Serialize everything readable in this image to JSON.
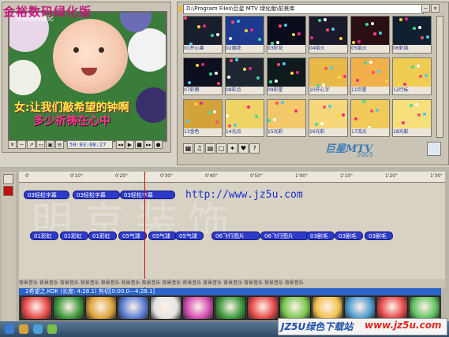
{
  "preview": {
    "title": "金裕数码绿化版",
    "subtitle": "金裕数码绿化",
    "lyric_line1": "让我们敲希望的钟啊",
    "lyric_line2": "多少祈祷在心中",
    "lyric_prefix": "女:",
    "timecode": "59:03:00:27"
  },
  "library": {
    "path": "D:\\Program Files\\巨星 MTV 绿化版\\前景库",
    "thumbs": [
      {
        "label": "01开心果",
        "color": "#1a1f2e"
      },
      {
        "label": "02烟花",
        "color": "#1d3a8e"
      },
      {
        "label": "03彩花",
        "color": "#0b0d1c"
      },
      {
        "label": "04焰火",
        "color": "#1a1a2a"
      },
      {
        "label": "05焰火",
        "color": "#2a0f14"
      },
      {
        "label": "06彩焰",
        "color": "#112030"
      },
      {
        "label": "07彩雨",
        "color": "#0c0f1d"
      },
      {
        "label": "08彩点",
        "color": "#1c2530"
      },
      {
        "label": "09彩星",
        "color": "#0f1a1d"
      },
      {
        "label": "10开心字",
        "color": "#e8b947"
      },
      {
        "label": "11巨星",
        "color": "#f2b04a"
      },
      {
        "label": "12行标",
        "color": "#f0cc52"
      },
      {
        "label": "13金色",
        "color": "#d4a23a"
      },
      {
        "label": "14光点",
        "color": "#efd364"
      },
      {
        "label": "15光彩",
        "color": "#f3c86a"
      },
      {
        "label": "16光彩",
        "color": "#f6d87a"
      },
      {
        "label": "17流光",
        "color": "#f2ca5a"
      },
      {
        "label": "18光影",
        "color": "#f7e07c"
      }
    ],
    "logo": "巨星MTV",
    "logo_year": "2003"
  },
  "timeline": {
    "ruler_ticks": [
      "0'",
      "0'10\"",
      "0'20\"",
      "0'30\"",
      "0'40\"",
      "0'50\"",
      "1'00\"",
      "1'10\"",
      "1'20\"",
      "1'30\""
    ],
    "watermark": "明京装饰",
    "url": "http://www.jz5u.com",
    "clips_row1": [
      "03轻松字幕",
      "03轻松字幕",
      "03轻松字幕"
    ],
    "clips_row2": [
      "01彩虹",
      "01彩虹",
      "01彩虹",
      "05气球",
      "05气球",
      "05气球",
      "06飞行图片",
      "06飞行图片",
      "03剧毛",
      "03剧毛",
      "03剧毛"
    ],
    "bg_track_label": "背景音乐",
    "music_label": "2希望之.KOK (长度: 4:28.1) 剪切[0:00.0—4:28.1]",
    "music_label2": "(长度: 4:28.1) 剪切[0:00.0—4:28.1]"
  },
  "taskbar": {
    "brand": "JZ5U绿色下载站",
    "brand_link": "www.jz5u.com"
  },
  "colors": {
    "accent": "#2d3ac8",
    "title": "#c2187a",
    "brand": "#1f4fa8"
  }
}
